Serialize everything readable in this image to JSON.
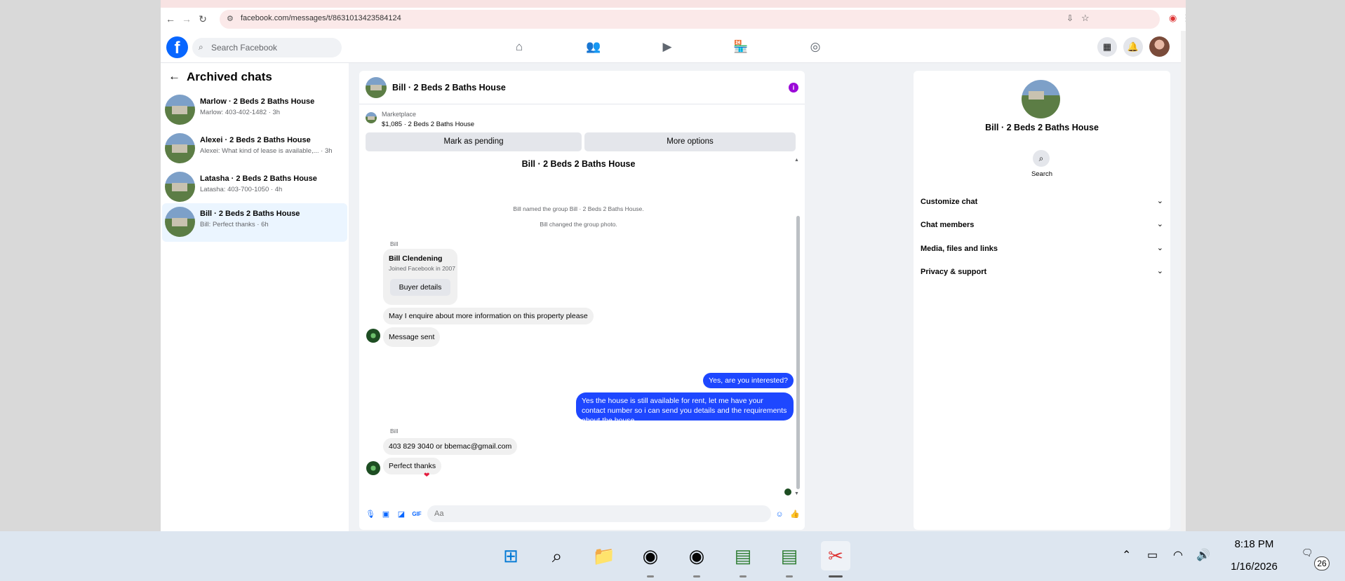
{
  "browser": {
    "url": "facebook.com/messages/t/8631013423584124"
  },
  "facebook": {
    "logo": "f",
    "search_placeholder": "Search Facebook",
    "nav_icons": [
      "home-icon",
      "friends-icon",
      "video-icon",
      "marketplace-icon",
      "groups-icon"
    ]
  },
  "sidebar": {
    "title": "Archived chats",
    "chats": [
      {
        "name": "Marlow · 2 Beds 2 Baths House",
        "preview": "Marlow: 403-402-1482 · 3h"
      },
      {
        "name": "Alexei · 2 Beds 2 Baths House",
        "preview": "Alexei: What kind of lease is available,... · 3h"
      },
      {
        "name": "Latasha · 2 Beds 2 Baths House",
        "preview": "Latasha: 403-700-1050 · 4h"
      },
      {
        "name": "Bill · 2 Beds 2 Baths House",
        "preview": "Bill: Perfect thanks · 6h"
      }
    ]
  },
  "conversation": {
    "title": "Bill · 2 Beds 2 Baths House",
    "marketplace_label": "Marketplace",
    "listing": "$1,085 · 2 Beds 2 Baths House",
    "mark_pending": "Mark as pending",
    "more_options": "More options",
    "thread_title": "Bill · 2 Beds 2 Baths House",
    "system_msgs": [
      "Bill named the group Bill · 2 Beds 2 Baths House.",
      "Bill changed the group photo."
    ],
    "sender_1": "Bill",
    "card_name": "Bill Clendening",
    "card_sub": "Joined Facebook in 2007",
    "card_button": "Buyer details",
    "msg_in_1": "May I enquire about more information on this property please",
    "msg_in_2": "Message sent",
    "msg_out_1": "Yes, are you interested?",
    "msg_out_2": "Yes the house is still available for rent, let me have your contact number so i can send you details and the requirements about the house",
    "sender_2": "Bill",
    "msg_in_3": "403 829 3040 or bbemac@gmail.com",
    "msg_in_4": "Perfect thanks",
    "reaction": "❤",
    "input_placeholder": "Aa"
  },
  "details": {
    "title": "Bill · 2 Beds 2 Baths House",
    "search_label": "Search",
    "rows": [
      "Customize chat",
      "Chat members",
      "Media, files and links",
      "Privacy & support"
    ]
  },
  "taskbar": {
    "time": "8:18 PM",
    "date": "1/16/2026",
    "notifications": "26"
  }
}
